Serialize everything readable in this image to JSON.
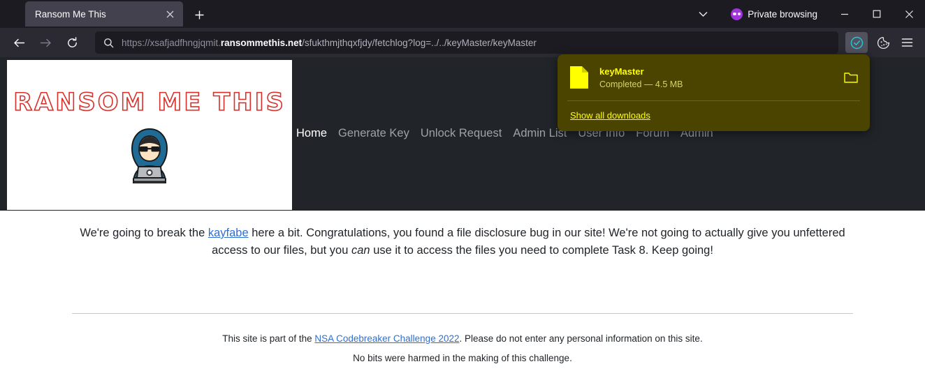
{
  "browser": {
    "tab": {
      "title": "Ransom Me This",
      "close_icon": "close-icon"
    },
    "new_tab_icon": "plus-icon",
    "list_tabs_icon": "chevron-down-icon",
    "private_browsing_label": "Private browsing",
    "private_icon": "mask-icon",
    "window_controls": {
      "minimize": "minimize-icon",
      "maximize": "maximize-icon",
      "close": "close-icon"
    },
    "nav": {
      "back_icon": "back-arrow-icon",
      "forward_icon": "forward-arrow-icon",
      "reload_icon": "reload-icon"
    },
    "url": {
      "search_icon": "search-icon",
      "scheme": "https://xsafjadfhngjqmit.",
      "host": "ransommethis.net",
      "path": "/sfukthmjthqxfjdy/fetchlog?log=../../keyMaster/keyMaster",
      "full": "https://xsafjadfhngjqmit.ransommethis.net/sfukthmjthqxfjdy/fetchlog?log=../../keyMaster/keyMaster"
    },
    "toolbar": {
      "downloads_icon": "download-complete-check-icon",
      "downloads_accent": "#25c4d4",
      "cookie_icon": "cookie-icon",
      "menu_icon": "hamburger-menu-icon"
    }
  },
  "downloads_panel": {
    "background": "#4a4400",
    "accent": "#ffff00",
    "file_icon": "file-icon",
    "item": {
      "name": "keyMaster",
      "status": "Completed — 4.5 MB",
      "open_folder_icon": "folder-icon"
    },
    "show_all_label": "Show all downloads"
  },
  "page": {
    "logo": {
      "title": "RANSOM ME THIS",
      "title_color": "#d8302a",
      "graphic": "hacker-with-laptop-icon"
    },
    "nav_items": [
      {
        "label": "Home",
        "active": true
      },
      {
        "label": "Generate Key",
        "active": false
      },
      {
        "label": "Unlock Request",
        "active": false
      },
      {
        "label": "Admin List",
        "active": false
      },
      {
        "label": "User Info",
        "active": false
      },
      {
        "label": "Forum",
        "active": false
      },
      {
        "label": "Admin",
        "active": false
      }
    ],
    "body": {
      "part1": "We're going to break the ",
      "link": "kayfabe",
      "part2": " here a bit. Congratulations, you found a file disclosure bug in our site! We're not going to actually give you unfettered access to our files, but you ",
      "emphasis": "can",
      "part3": " use it to access the files you need to complete Task 8. Keep going!"
    },
    "footer": {
      "line1_part1": "This site is part of the ",
      "line1_link": "NSA Codebreaker Challenge 2022",
      "line1_part2": ". Please do not enter any personal information on this site.",
      "line2": "No bits were harmed in the making of this challenge."
    }
  }
}
